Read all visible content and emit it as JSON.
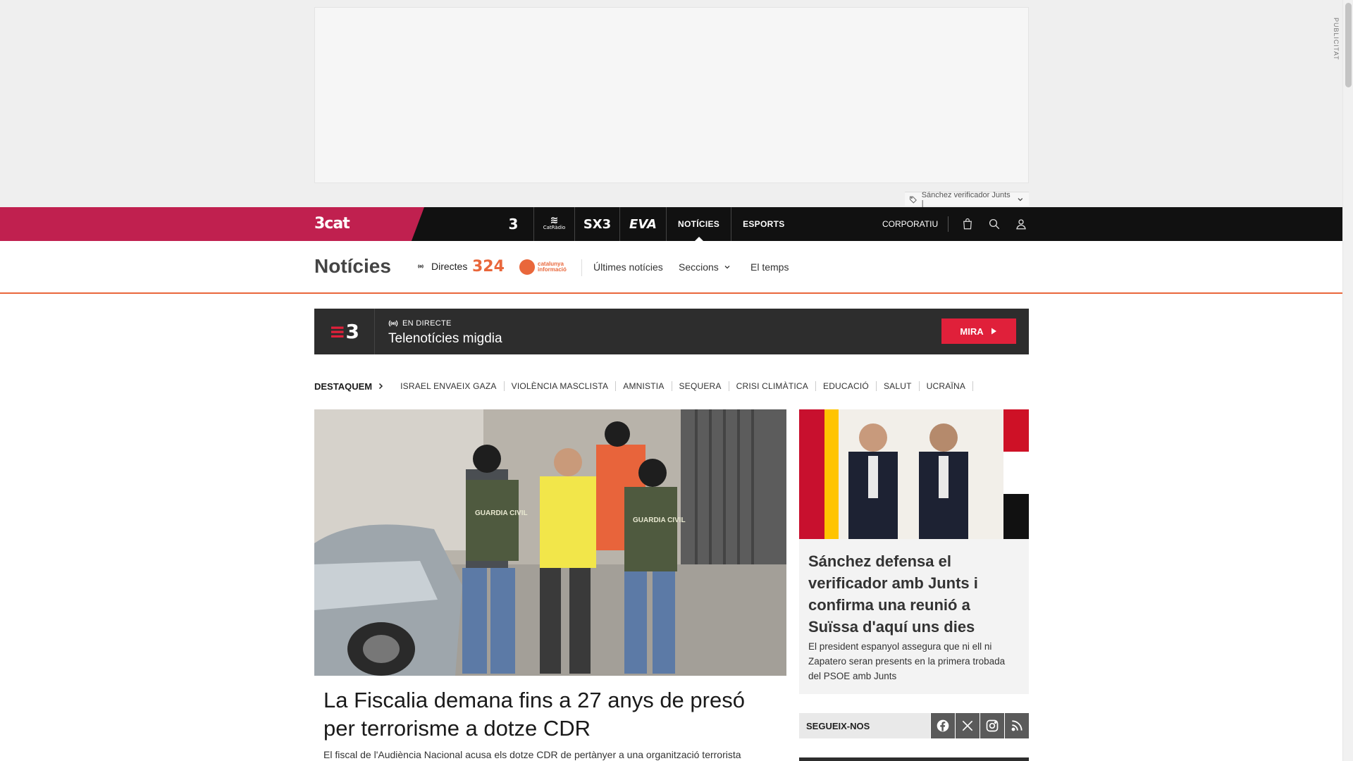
{
  "ad": {
    "label": "PUBLICITAT",
    "tag": "Sánchez verificador Junts |"
  },
  "topnav": {
    "brand": "3cat",
    "channels": [
      "3",
      "CatRàdio",
      "SX3",
      "EVA"
    ],
    "links": [
      "NOTÍCIES",
      "ESPORTS"
    ],
    "active": "NOTÍCIES",
    "corporate": "CORPORATIU"
  },
  "section": {
    "title": "Notícies",
    "live_label": "Directes",
    "logo_324": "324",
    "logo_ci": "catalunya informació",
    "links": [
      "Últimes notícies",
      "Seccions",
      "El temps"
    ]
  },
  "live": {
    "status": "EN DIRECTE",
    "title": "Telenotícies migdia",
    "button": "MIRA"
  },
  "highlights": {
    "lead": "DESTAQUEM",
    "topics": [
      "ISRAEL ENVAEIX GAZA",
      "VIOLÈNCIA MASCLISTA",
      "AMNISTIA",
      "SEQUERA",
      "CRISI CLIMÀTICA",
      "EDUCACIÓ",
      "SALUT",
      "UCRAÏNA"
    ]
  },
  "main_article": {
    "headline": "La Fiscalia demana fins a 27 anys de presó per terrorisme a dotze CDR",
    "lede": "El fiscal de l'Audiència Nacional acusa els dotze CDR de pertànyer a una organització terrorista paral·lela,",
    "image_text": "GUARDIA CIVIL"
  },
  "side_article": {
    "headline": "Sánchez defensa el verificador amb Junts i confirma una reunió a Suïssa d'aquí uns dies",
    "lede": "El president espanyol assegura que ni ell ni Zapatero seran presents en la primera trobada del PSOE amb Junts"
  },
  "follow": {
    "label": "SEGUEIX-NOS",
    "networks": [
      "facebook-icon",
      "x-icon",
      "instagram-icon",
      "rss-icon"
    ]
  },
  "colors": {
    "brand": "#c0204f",
    "accent": "#e9673b",
    "live_red": "#e0203a",
    "nav_bg": "#111111"
  }
}
